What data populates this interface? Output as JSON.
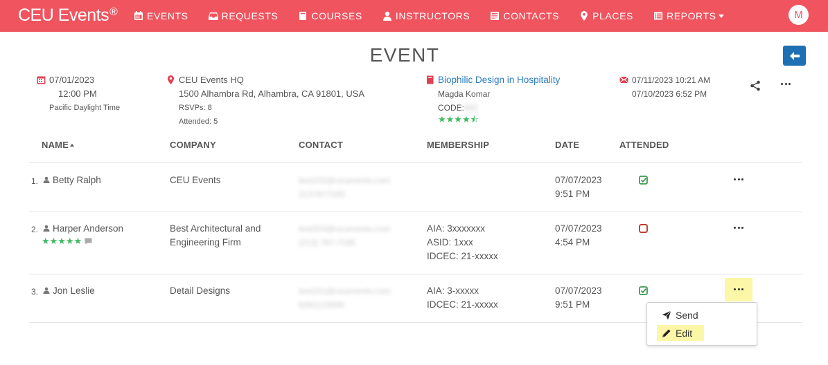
{
  "nav": {
    "brand": "CEU Events",
    "brand_mark": "®",
    "items": [
      {
        "label": "EVENTS",
        "icon": "calendar-icon"
      },
      {
        "label": "REQUESTS",
        "icon": "inbox-icon"
      },
      {
        "label": "COURSES",
        "icon": "book-icon"
      },
      {
        "label": "INSTRUCTORS",
        "icon": "user-icon"
      },
      {
        "label": "CONTACTS",
        "icon": "address-book-icon"
      },
      {
        "label": "PLACES",
        "icon": "map-marker-icon"
      },
      {
        "label": "REPORTS",
        "icon": "list-icon"
      }
    ],
    "avatar_initial": "M"
  },
  "page": {
    "title": "EVENT"
  },
  "event": {
    "date": "07/01/2023",
    "time": "12:00 PM",
    "timezone": "Pacific Daylight Time",
    "place_name": "CEU Events HQ",
    "place_address": "1500 Alhambra Rd, Alhambra, CA 91801, USA",
    "rsvps": "RSVPs: 8",
    "attended": "Attended: 5",
    "course_title": "Biophilic Design in Hospitality",
    "instructor": "Magda Komar",
    "code_label": "CODE:",
    "code_value": "882",
    "course_stars": "★★★★⯪",
    "email_sent_1": "07/11/2023 10:21 AM",
    "email_sent_2": "07/10/2023 6:52 PM"
  },
  "table": {
    "headers": [
      "NAME",
      "COMPANY",
      "CONTACT",
      "MEMBERSHIP",
      "DATE",
      "ATTENDED"
    ],
    "rows": [
      {
        "num": "1.",
        "name": "Betty Ralph",
        "company_1": "CEU Events",
        "company_2": "",
        "contact_email": "test102@ceuevents.com",
        "contact_phone": "2137877165",
        "membership_1": "",
        "membership_2": "",
        "membership_3": "",
        "date": "07/07/2023",
        "time": "9:51 PM",
        "attended": true
      },
      {
        "num": "2.",
        "name": "Harper Anderson",
        "rating": "★★★★★",
        "company_1": "Best Architectural and",
        "company_2": "Engineering Firm",
        "contact_email": "test203@ceuevents.com",
        "contact_phone": "(213) 787-7165",
        "membership_1": "AIA: 3xxxxxxx",
        "membership_2": "ASID: 1xxx",
        "membership_3": "IDCEC: 21-xxxxx",
        "date": "07/07/2023",
        "time": "4:54 PM",
        "attended": false
      },
      {
        "num": "3.",
        "name": "Jon Leslie",
        "company_1": "Detail Designs",
        "company_2": "",
        "contact_email": "test101@ceuevents.com",
        "contact_phone": "6261123000",
        "membership_1": "AIA: 3-xxxxx",
        "membership_2": "IDCEC: 21-xxxxx",
        "membership_3": "",
        "date": "07/07/2023",
        "time": "9:51 PM",
        "attended": true
      }
    ]
  },
  "dropdown": {
    "send_label": "Send",
    "edit_label": "Edit"
  },
  "colors": {
    "navbar": "#f0545f",
    "link": "#2b7bbf",
    "back_button": "#1f6fb4",
    "attended_check": "#3a9a4e",
    "not_attended": "#c0392b",
    "stars": "#3dba5f",
    "highlight": "#fbf7a6"
  }
}
